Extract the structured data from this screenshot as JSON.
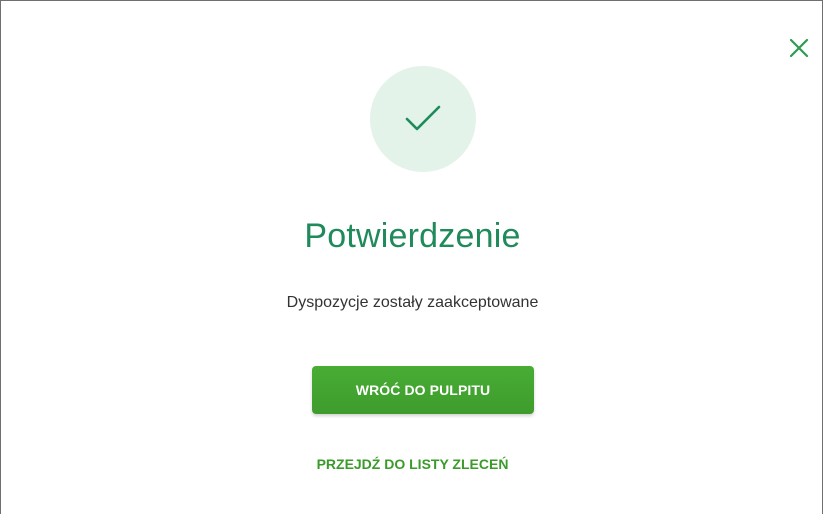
{
  "dialog": {
    "title": "Potwierdzenie",
    "message": "Dyspozycje zostały zaakceptowane",
    "primary_button_label": "WRÓĆ DO PULPITU",
    "secondary_link_label": "PRZEJDŹ DO LISTY ZLECEŃ",
    "close_icon": "close-icon",
    "status_icon": "checkmark-icon"
  },
  "colors": {
    "accent_text": "#1f8a5a",
    "button_green": "#43a530",
    "link_green": "#3a9a2a",
    "success_circle_bg": "#e3f3e9"
  }
}
